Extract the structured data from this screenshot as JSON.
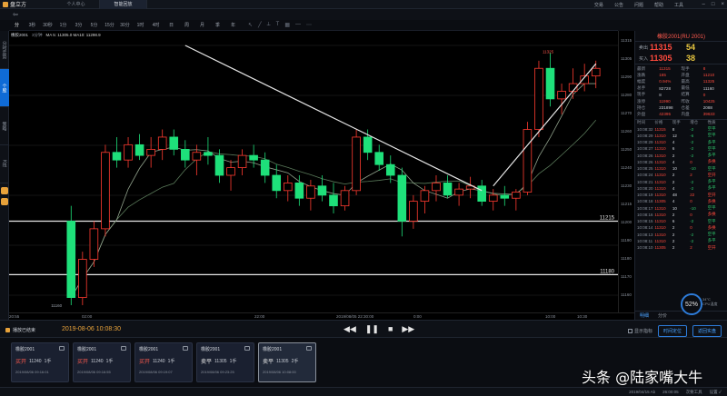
{
  "app": {
    "logo": "盘立方",
    "tabs": [
      "个人中心",
      "智能回放"
    ],
    "menu": [
      "交易",
      "公告",
      "问题",
      "帮助",
      "工具"
    ]
  },
  "periods": [
    "分",
    "3秒",
    "30秒",
    "1分",
    "3分",
    "5分",
    "15分",
    "30分",
    "1时",
    "4时",
    "日",
    "周",
    "月",
    "季",
    "年"
  ],
  "left_rail": [
    "分时走势",
    "个股",
    "策略",
    "K线"
  ],
  "chart_info": {
    "code": "橡胶2001",
    "period": "3分钟",
    "ma": "MA 5: 11305.0   MA10: 11298.9"
  },
  "levels": [
    {
      "label": "11215",
      "price": 11215
    },
    {
      "label": "11180",
      "price": 11180
    }
  ],
  "annotations": {
    "low": "11160",
    "high": "11325"
  },
  "y_ticks": [
    "11315",
    "11305",
    "11290",
    "11280",
    "11270",
    "11260",
    "11250",
    "11240",
    "11230",
    "11215",
    "11200",
    "11190",
    "11180",
    "11170",
    "11160"
  ],
  "x_ticks": [
    "20:55",
    "02:00",
    "22:00",
    "2019/08/05 22:30:00",
    "0:00",
    "10:00",
    "10:30"
  ],
  "side": {
    "title": "橡胶2001(RU 2001)",
    "sell": {
      "label": "卖出",
      "price": "11315",
      "vol": "54"
    },
    "buy": {
      "label": "买入",
      "price": "11305",
      "vol": "38"
    },
    "stats": [
      [
        "最新",
        "11315",
        "现手",
        "8"
      ],
      [
        "涨跌",
        "165",
        "开盘",
        "11210"
      ],
      [
        "幅度",
        "0.94%",
        "最高",
        "11325"
      ],
      [
        "总手",
        "82728",
        "最低",
        "11160"
      ],
      [
        "现手",
        "8",
        "结算",
        "0"
      ],
      [
        "涨停",
        "11990",
        "昨收",
        "10425"
      ],
      [
        "持仓",
        "231898",
        "仓差",
        "2088"
      ],
      [
        "外盘",
        "42395",
        "内盘",
        "39633"
      ]
    ],
    "tick_cols": [
      "时间",
      "价格",
      "现手",
      "增仓",
      "性质"
    ],
    "ticks": [
      [
        "10:08:32",
        "11315",
        "8",
        "-2",
        "空平"
      ],
      [
        "10:08:29",
        "11310",
        "12",
        "-6",
        "空平"
      ],
      [
        "10:08:29",
        "11310",
        "4",
        "-2",
        "多平"
      ],
      [
        "10:08:27",
        "11310",
        "6",
        "-2",
        "空平"
      ],
      [
        "10:08:26",
        "11310",
        "2",
        "-2",
        "多平"
      ],
      [
        "10:08:26",
        "11310",
        "4",
        "0",
        "多换"
      ],
      [
        "10:08:25",
        "11310",
        "10",
        "-10",
        "空平"
      ],
      [
        "10:08:24",
        "11310",
        "2",
        "2",
        "空开"
      ],
      [
        "10:08:21",
        "11310",
        "2",
        "-2",
        "多平"
      ],
      [
        "10:08:20",
        "11310",
        "4",
        "-2",
        "多平"
      ],
      [
        "10:08:19",
        "11310",
        "48",
        "22",
        "空开"
      ],
      [
        "10:08:18",
        "11305",
        "4",
        "0",
        "多换"
      ],
      [
        "10:08:17",
        "11310",
        "10",
        "-10",
        "空平"
      ],
      [
        "10:08:16",
        "11310",
        "2",
        "0",
        "多换"
      ],
      [
        "10:08:15",
        "11310",
        "6",
        "-2",
        "空平"
      ],
      [
        "10:08:14",
        "11310",
        "2",
        "0",
        "多换"
      ],
      [
        "10:08:13",
        "11310",
        "2",
        "-2",
        "空平"
      ],
      [
        "10:08:11",
        "11310",
        "2",
        "-2",
        "多平"
      ],
      [
        "10:08:10",
        "11305",
        "2",
        "2",
        "空开"
      ]
    ],
    "tabs": [
      "明细",
      "分价"
    ],
    "gauge": {
      "value": "52%",
      "caption1": "34°C",
      "caption2": "CPU温度"
    }
  },
  "replay": {
    "title": "播放已结束",
    "date": "2019-08-06 10:08:30",
    "controls": [
      "◀◀",
      "❚❚",
      "■",
      "▶▶"
    ],
    "checkbox": "显示指标",
    "btn1": "时间定位",
    "btn2": "返回实盘"
  },
  "trades": [
    {
      "name": "橡胶2001",
      "action": "买开",
      "price": "11240",
      "qty": "1手",
      "time": "2019/08/06 09:16:01"
    },
    {
      "name": "橡胶2001",
      "action": "买开",
      "price": "11240",
      "qty": "1手",
      "time": "2019/08/06 09:16:55"
    },
    {
      "name": "橡胶2001",
      "action": "买开",
      "price": "11240",
      "qty": "1手",
      "time": "2019/08/06 09:19:07"
    },
    {
      "name": "橡胶2001",
      "action": "卖平",
      "price": "11305",
      "qty": "1手",
      "time": "2019/08/06 09:23:25"
    },
    {
      "name": "橡胶2001",
      "action": "卖平",
      "price": "11305",
      "qty": "2手",
      "time": "2019/08/06 10:08:00"
    }
  ],
  "status": {
    "items": [
      "2019/04/15 Ab",
      "26:00:05",
      "次要工具",
      "设置 ✓"
    ]
  },
  "watermark": "头条 @陆家嘴大牛",
  "chart_data": {
    "type": "candlestick",
    "y_range": [
      11160,
      11330
    ],
    "candles": [
      [
        11215,
        11225,
        11160,
        11165
      ],
      [
        11165,
        11195,
        11160,
        11190
      ],
      [
        11190,
        11215,
        11185,
        11210
      ],
      [
        11210,
        11265,
        11205,
        11260
      ],
      [
        11260,
        11270,
        11250,
        11255
      ],
      [
        11255,
        11270,
        11250,
        11265
      ],
      [
        11265,
        11272,
        11255,
        11258
      ],
      [
        11258,
        11270,
        11250,
        11262
      ],
      [
        11262,
        11275,
        11255,
        11270
      ],
      [
        11270,
        11275,
        11258,
        11262
      ],
      [
        11262,
        11268,
        11250,
        11255
      ],
      [
        11255,
        11265,
        11245,
        11260
      ],
      [
        11260,
        11270,
        11252,
        11258
      ],
      [
        11258,
        11262,
        11240,
        11245
      ],
      [
        11245,
        11255,
        11235,
        11250
      ],
      [
        11250,
        11262,
        11245,
        11258
      ],
      [
        11258,
        11265,
        11250,
        11255
      ],
      [
        11255,
        11260,
        11240,
        11245
      ],
      [
        11245,
        11252,
        11230,
        11235
      ],
      [
        11235,
        11245,
        11228,
        11240
      ],
      [
        11240,
        11245,
        11225,
        11230
      ],
      [
        11230,
        11242,
        11222,
        11238
      ],
      [
        11238,
        11245,
        11228,
        11232
      ],
      [
        11232,
        11240,
        11220,
        11225
      ],
      [
        11225,
        11238,
        11222,
        11235
      ],
      [
        11235,
        11275,
        11232,
        11270
      ],
      [
        11270,
        11275,
        11255,
        11260
      ],
      [
        11260,
        11265,
        11248,
        11252
      ],
      [
        11252,
        11258,
        11240,
        11245
      ],
      [
        11245,
        11250,
        11205,
        11215
      ],
      [
        11215,
        11232,
        11210,
        11228
      ],
      [
        11228,
        11238,
        11220,
        11235
      ],
      [
        11235,
        11245,
        11228,
        11240
      ],
      [
        11240,
        11245,
        11230,
        11232
      ],
      [
        11232,
        11240,
        11225,
        11236
      ],
      [
        11236,
        11244,
        11230,
        11238
      ],
      [
        11238,
        11242,
        11225,
        11228
      ],
      [
        11228,
        11236,
        11222,
        11232
      ],
      [
        11232,
        11238,
        11225,
        11230
      ],
      [
        11230,
        11236,
        11222,
        11234
      ],
      [
        11234,
        11280,
        11232,
        11275
      ],
      [
        11275,
        11320,
        11270,
        11315
      ],
      [
        11315,
        11325,
        11290,
        11295
      ],
      [
        11295,
        11305,
        11285,
        11300
      ],
      [
        11300,
        11315,
        11295,
        11305
      ],
      [
        11305,
        11318,
        11300,
        11310
      ],
      [
        11310,
        11320,
        11302,
        11315
      ]
    ],
    "trend_lines": [
      {
        "from": [
          10,
          11330
        ],
        "to": [
          36,
          11235
        ]
      },
      {
        "from": [
          37,
          11238
        ],
        "to": [
          46,
          11318
        ]
      }
    ]
  }
}
